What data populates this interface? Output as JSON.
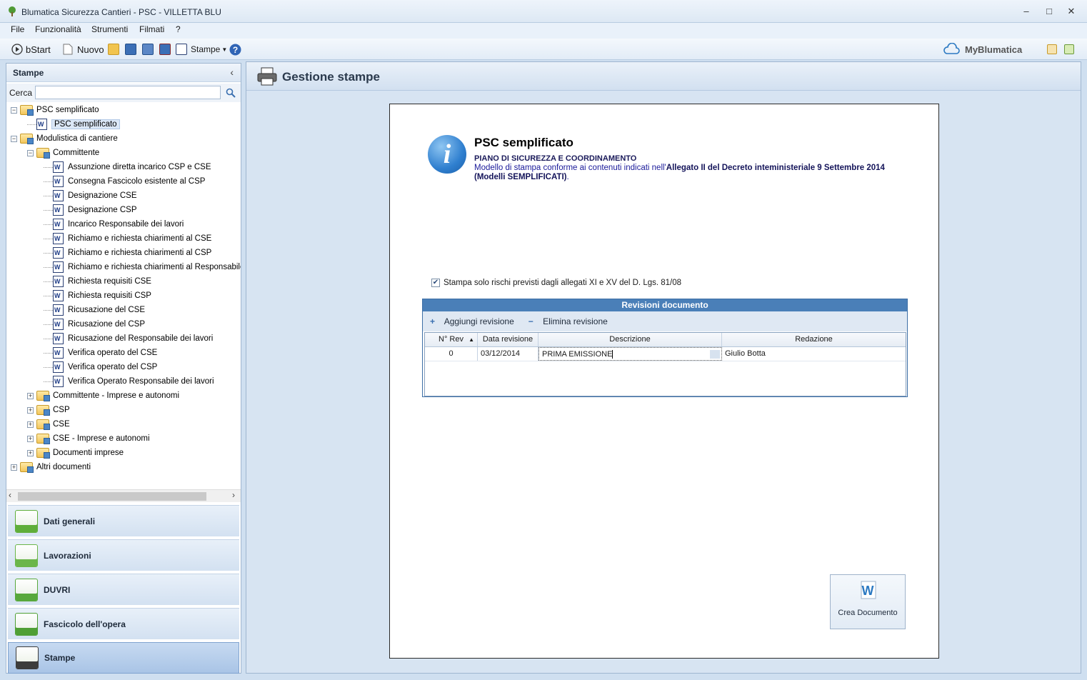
{
  "window": {
    "title": "Blumatica Sicurezza Cantieri - PSC - VILLETTA BLU",
    "minimize": "‒",
    "maximize": "□",
    "close": "✕"
  },
  "menu": [
    "File",
    "Funzionalità",
    "Strumenti",
    "Filmati",
    "?"
  ],
  "toolbar": {
    "bstart": "bStart",
    "nuovo": "Nuovo",
    "stampe": "Stampe",
    "brand": "MyBlumatica"
  },
  "left": {
    "title": "Stampe",
    "collapse": "‹",
    "search_label": "Cerca",
    "search_value": "",
    "tree": [
      {
        "label": "PSC semplificato",
        "type": "folder",
        "level": 0,
        "expander": "−"
      },
      {
        "label": "PSC semplificato",
        "type": "doc",
        "level": 1,
        "selected": true
      },
      {
        "label": "Modulistica di cantiere",
        "type": "folder",
        "level": 0,
        "expander": "−"
      },
      {
        "label": "Committente",
        "type": "folder",
        "level": 1,
        "expander": "−"
      },
      {
        "label": "Assunzione diretta incarico CSP e CSE",
        "type": "doc",
        "level": 2
      },
      {
        "label": "Consegna Fascicolo esistente al CSP",
        "type": "doc",
        "level": 2
      },
      {
        "label": "Designazione CSE",
        "type": "doc",
        "level": 2
      },
      {
        "label": "Designazione CSP",
        "type": "doc",
        "level": 2
      },
      {
        "label": "Incarico Responsabile dei lavori",
        "type": "doc",
        "level": 2
      },
      {
        "label": "Richiamo e richiesta chiarimenti al CSE",
        "type": "doc",
        "level": 2
      },
      {
        "label": "Richiamo e richiesta chiarimenti al CSP",
        "type": "doc",
        "level": 2
      },
      {
        "label": "Richiamo e richiesta chiarimenti al Responsabile d",
        "type": "doc",
        "level": 2
      },
      {
        "label": "Richiesta requisiti CSE",
        "type": "doc",
        "level": 2
      },
      {
        "label": "Richiesta requisiti CSP",
        "type": "doc",
        "level": 2
      },
      {
        "label": "Ricusazione del CSE",
        "type": "doc",
        "level": 2
      },
      {
        "label": "Ricusazione del CSP",
        "type": "doc",
        "level": 2
      },
      {
        "label": "Ricusazione del Responsabile dei lavori",
        "type": "doc",
        "level": 2
      },
      {
        "label": "Verifica operato del CSE",
        "type": "doc",
        "level": 2
      },
      {
        "label": "Verifica operato del CSP",
        "type": "doc",
        "level": 2
      },
      {
        "label": "Verifica Operato Responsabile dei lavori",
        "type": "doc",
        "level": 2
      },
      {
        "label": "Committente - Imprese e autonomi",
        "type": "folder",
        "level": 1,
        "expander": "+"
      },
      {
        "label": "CSP",
        "type": "folder",
        "level": 1,
        "expander": "+"
      },
      {
        "label": "CSE",
        "type": "folder",
        "level": 1,
        "expander": "+"
      },
      {
        "label": "CSE - Imprese e autonomi",
        "type": "folder",
        "level": 1,
        "expander": "+"
      },
      {
        "label": "Documenti imprese",
        "type": "folder",
        "level": 1,
        "expander": "+"
      },
      {
        "label": "Altri documenti",
        "type": "folder",
        "level": 0,
        "expander": "+"
      }
    ],
    "scroll_left": "‹",
    "scroll_right": "›",
    "nav": [
      {
        "label": "Dati generali",
        "color": "#5fae3a"
      },
      {
        "label": "Lavorazioni",
        "color": "#6bb64a"
      },
      {
        "label": "DUVRI",
        "color": "#58a83c"
      },
      {
        "label": "Fascicolo dell'opera",
        "color": "#4f9f35"
      },
      {
        "label": "Stampe",
        "color": "#3c3c3c"
      }
    ]
  },
  "main": {
    "title": "Gestione stampe",
    "doc_title": "PSC semplificato",
    "doc_subtitle": "PIANO DI SICUREZZA E COORDINAMENTO",
    "desc_prefix": "Modello di stampa conforme ai contenuti indicati nell'",
    "desc_bold": "Allegato II del Decreto inteministeriale 9 Settembre 2014 (Modelli SEMPLIFICATI)",
    "desc_suffix": ".",
    "info_glyph": "i",
    "checkbox_label": "Stampa solo rischi previsti  dagli allegati XI e XV del D. Lgs. 81/08",
    "checkbox_checked": true,
    "revisions": {
      "title": "Revisioni documento",
      "add": "Aggiungi revisione",
      "remove": "Elimina revisione",
      "columns": [
        "N° Rev",
        "Data revisione",
        "Descrizione",
        "Redazione"
      ],
      "rows": [
        {
          "rev": "0",
          "date": "03/12/2014",
          "desc": "PRIMA EMISSIONE",
          "author": "Giulio Botta"
        }
      ]
    },
    "create_button": "Crea Documento"
  }
}
